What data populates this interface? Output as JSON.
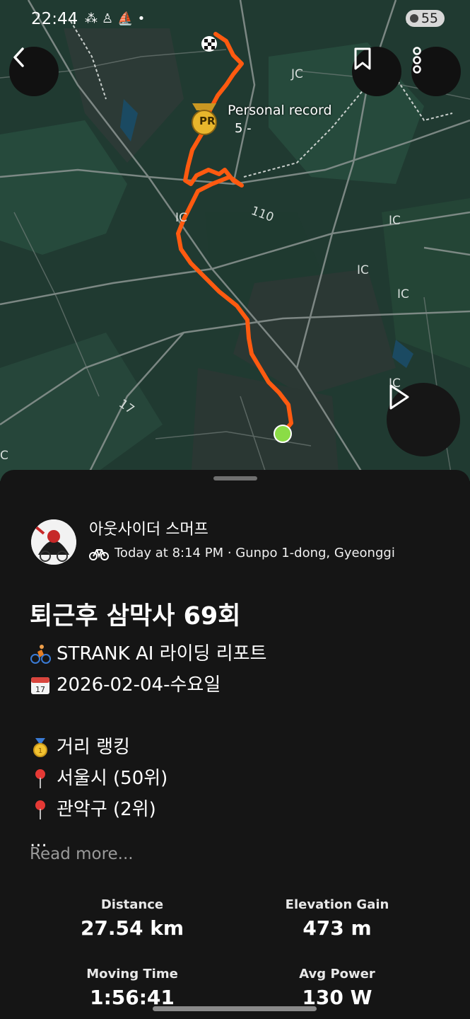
{
  "status_bar": {
    "time": "22:44",
    "left_icons": [
      "notification-icon",
      "android-icon",
      "boat-icon",
      "dot-icon"
    ],
    "right_icons": [
      "wifi-icon",
      "signal-icon"
    ],
    "battery": "55"
  },
  "map": {
    "pr_label": "Personal record",
    "pr_sub": "5 -",
    "pr_badge": "PR",
    "road_labels": [
      "JC",
      "IC",
      "110",
      "IC",
      "IC",
      "IC",
      "IC",
      "17",
      "C"
    ]
  },
  "actions": {
    "back_icon": "chevron-left-icon",
    "bookmark_icon": "bookmark-icon",
    "more_icon": "more-vertical-icon",
    "play_icon": "play-icon"
  },
  "activity": {
    "athlete_name": "아웃사이더 스머프",
    "meta": "Today at 8:14 PM · Gunpo 1-dong, Gyeonggi",
    "title": "퇴근후 삼막사 69회",
    "description": [
      {
        "icon": "cyclist-emoji",
        "text": "STRANK AI 라이딩 리포트"
      },
      {
        "icon": "calendar-emoji",
        "text": "2026-02-04-수요일"
      },
      {
        "icon": "",
        "text": ""
      },
      {
        "icon": "medal-emoji",
        "text": "거리 랭킹"
      },
      {
        "icon": "pin-emoji",
        "text": "서울시 (50위)"
      },
      {
        "icon": "pin-emoji",
        "text": "관악구 (2위)"
      },
      {
        "icon": "",
        "text": "..."
      }
    ],
    "read_more": "Read more..."
  },
  "stats": [
    {
      "label": "Distance",
      "value": "27.54 km"
    },
    {
      "label": "Elevation Gain",
      "value": "473 m"
    },
    {
      "label": "Moving Time",
      "value": "1:56:41"
    },
    {
      "label": "Avg Power",
      "value": "130 W"
    }
  ],
  "colors": {
    "route": "#ff5a10",
    "map_bg": "#203a31",
    "sheet_bg": "#151515",
    "end_marker": "#8bdc46",
    "pr_badge": "#e8b62c"
  }
}
